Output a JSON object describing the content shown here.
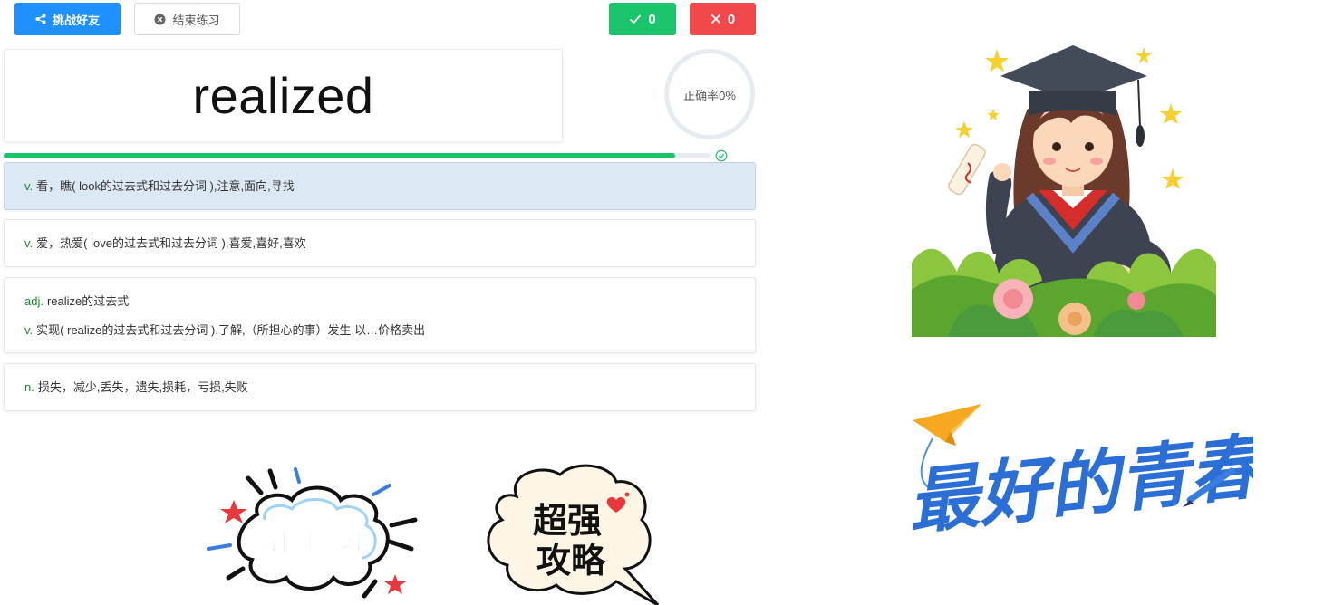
{
  "toolbar": {
    "challenge_label": "挑战好友",
    "end_label": "结束练习",
    "correct_count": "0",
    "wrong_count": "0"
  },
  "word": "realized",
  "accuracy_label": "正确率0%",
  "progress": {
    "fraction": 0.95
  },
  "options": [
    {
      "selected": true,
      "lines": [
        {
          "pos": "v.",
          "text": "看，瞧( look的过去式和过去分词 ),注意,面向,寻找"
        }
      ]
    },
    {
      "selected": false,
      "lines": [
        {
          "pos": "v.",
          "text": "爱，热爱( love的过去式和过去分词 ),喜爱,喜好,喜欢"
        }
      ]
    },
    {
      "selected": false,
      "lines": [
        {
          "pos": "adj.",
          "text": "realize的过去式"
        },
        {
          "pos": "v.",
          "text": "实现( realize的过去式和过去分词 ),了解,（所担心的事）发生,以…价格卖出"
        }
      ]
    },
    {
      "selected": false,
      "lines": [
        {
          "pos": "n.",
          "text": "损失，减少,丢失，遗失,损耗，亏损,失败"
        }
      ]
    }
  ],
  "illustrations": {
    "timer_text": "计时练习",
    "strategy_line1": "超强",
    "strategy_line2": "攻略",
    "youth_text": "最好的青春"
  },
  "colors": {
    "primary": "#1e90ff",
    "correct": "#19c46a",
    "wrong": "#f0484b",
    "pos": "#1a8a2f",
    "selected_bg": "#dde8f5"
  },
  "icons": {
    "share": "share-icon",
    "close": "close-circle-icon",
    "check": "check-icon",
    "cross": "cross-icon"
  }
}
